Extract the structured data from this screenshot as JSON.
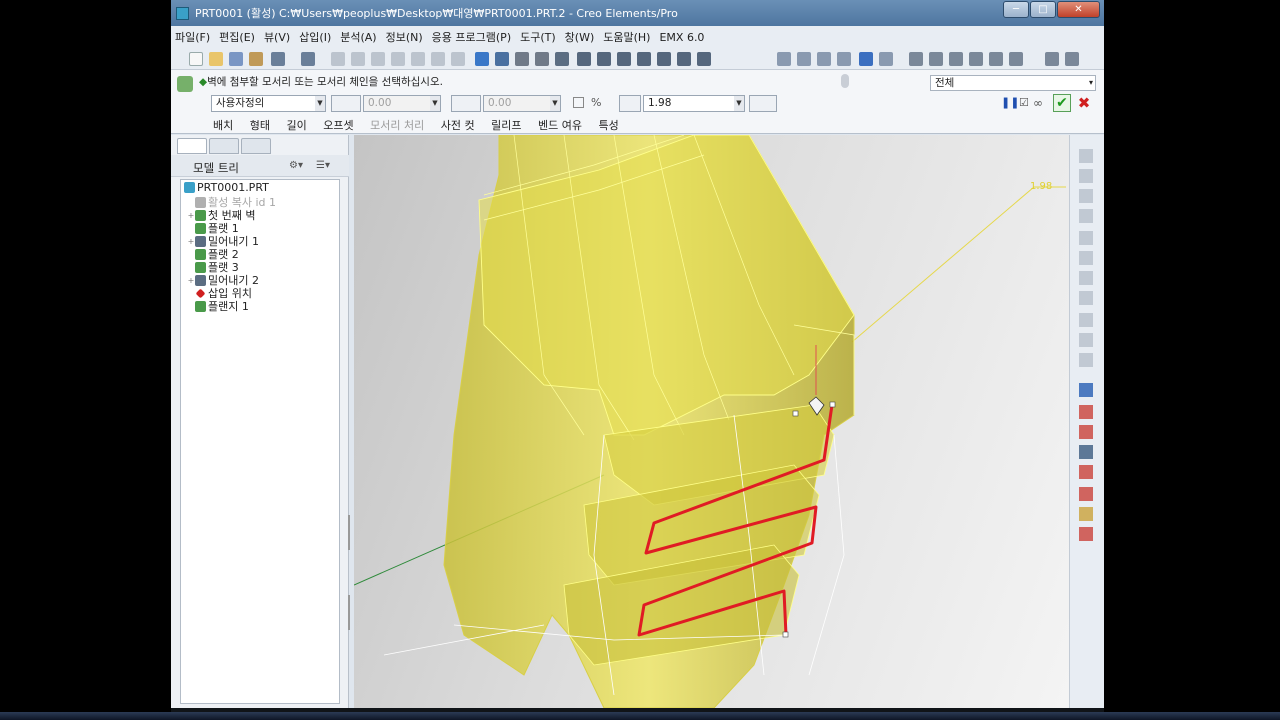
{
  "window": {
    "title": "PRT0001 (활성) C:₩Users₩peoplus₩Desktop₩대영₩PRT0001.PRT.2 - Creo Elements/Pro",
    "minimize": "─",
    "maximize": "□",
    "close": "✕"
  },
  "menu": [
    "파일(F)",
    "편집(E)",
    "뷰(V)",
    "삽입(I)",
    "분석(A)",
    "정보(N)",
    "응용 프로그램(P)",
    "도구(T)",
    "창(W)",
    "도움말(H)",
    "EMX 6.0"
  ],
  "dashboard": {
    "prompt_arrow": "◆",
    "prompt": "벽에 첨부할 모서리 또는 모서리 체인을 선택하십시오.",
    "shape_select": "사용자정의",
    "value1": "0.00",
    "value2": "0.00",
    "thickness": "1.98",
    "filter": "전체",
    "tabs": [
      "배치",
      "형태",
      "길이",
      "오프셋",
      "모서리 처리",
      "사전 컷",
      "릴리프",
      "벤드 여유",
      "특성"
    ],
    "disabled_tab_index": 4,
    "pause": "❚❚",
    "preview_check": "☑",
    "glasses": "∞",
    "ok": "✔",
    "cancel": "✖"
  },
  "model_tree": {
    "header": "모델 트리",
    "items": [
      {
        "label": "PRT0001.PRT",
        "icon": "part-icon",
        "level": 0,
        "expandable": false,
        "dim": false
      },
      {
        "label": "활성 복사 id 1",
        "icon": "copy-icon",
        "level": 1,
        "expandable": false,
        "dim": true
      },
      {
        "label": "첫 번째 벽",
        "icon": "wall-icon",
        "level": 1,
        "expandable": true,
        "dim": false
      },
      {
        "label": "플랫 1",
        "icon": "flat-wall-icon",
        "level": 1,
        "expandable": false,
        "dim": false
      },
      {
        "label": "밀어내기 1",
        "icon": "extrude-icon",
        "level": 1,
        "expandable": true,
        "dim": false
      },
      {
        "label": "플랫 2",
        "icon": "flat-wall-icon",
        "level": 1,
        "expandable": false,
        "dim": false
      },
      {
        "label": "플랫 3",
        "icon": "flat-wall-icon",
        "level": 1,
        "expandable": false,
        "dim": false
      },
      {
        "label": "밀어내기 2",
        "icon": "extrude-icon",
        "level": 1,
        "expandable": true,
        "dim": false
      },
      {
        "label": "삽입 위치",
        "icon": "insert-here-icon",
        "level": 1,
        "expandable": false,
        "dim": false
      },
      {
        "label": "플랜지 1",
        "icon": "flange-icon",
        "level": 1,
        "expandable": false,
        "dim": false
      }
    ]
  },
  "viewport": {
    "dimension_label": "1.98",
    "body_color": "#e6dc55",
    "edge_color": "#ffff88",
    "chain_color": "#e01b24"
  },
  "colors": {
    "titlebar": "#5a82ab",
    "accent_green": "#1d9a1d",
    "accent_red": "#d02020"
  }
}
